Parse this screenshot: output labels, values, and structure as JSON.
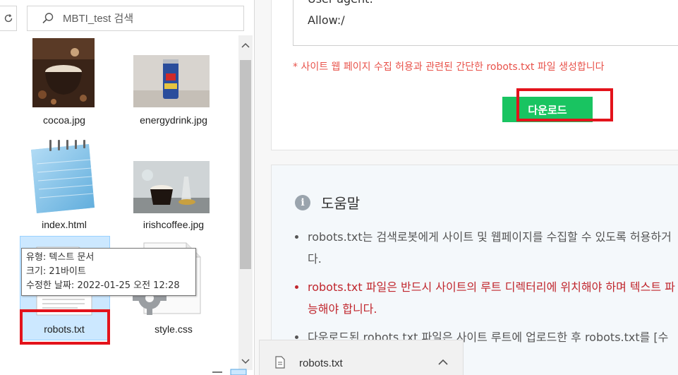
{
  "explorer": {
    "search": {
      "placeholder": "MBTI_test 검색"
    },
    "files": [
      {
        "name": "cocoa.jpg",
        "icon": "coffee-photo-thumbnail"
      },
      {
        "name": "energydrink.jpg",
        "icon": "energy-drink-photo-thumbnail"
      },
      {
        "name": "index.html",
        "icon": "notepad-icon"
      },
      {
        "name": "irishcoffee.jpg",
        "icon": "irish-coffee-photo-thumbnail"
      },
      {
        "name": "robots.txt",
        "icon": "text-document-icon"
      },
      {
        "name": "style.css",
        "icon": "css-gear-document-icon"
      }
    ],
    "tooltip": {
      "type_line": "유형: 텍스트 문서",
      "size_line": "크기: 21바이트",
      "modified_line": "수정한 날짜: 2022-01-25 오전 12:28"
    }
  },
  "web": {
    "code_lines": [
      "User-agent: *",
      "Allow:/"
    ],
    "notice": "* 사이트 웹 페이지 수집 허용과 관련된 간단한 robots.txt 파일 생성합니다",
    "download_label": "다운로드",
    "help": {
      "title": "도움말",
      "bullets": [
        {
          "line1": "robots.txt는 검색로봇에게 사이트 및 웹페이지를 수집할 수 있도록 허용하거",
          "line2": "다.",
          "color": "#555555"
        },
        {
          "line1": "robots.txt 파일은 반드시 사이트의 루트 디렉터리에 위치해야 하며 텍스트 파",
          "line2": "능해야 합니다.",
          "color": "#c0262d"
        },
        {
          "line1": "다운로드된 robots.txt 파일은 사이트 루트에 업로드한 후 robots.txt를 [수",
          "line2": "",
          "color": "#555555"
        }
      ]
    }
  },
  "download_shelf": {
    "file_name": "robots.txt"
  },
  "colors": {
    "accent_green": "#19c461",
    "highlight_red": "#e3131b",
    "notice_red": "#e8524a",
    "selection_blue": "#cce8ff"
  }
}
